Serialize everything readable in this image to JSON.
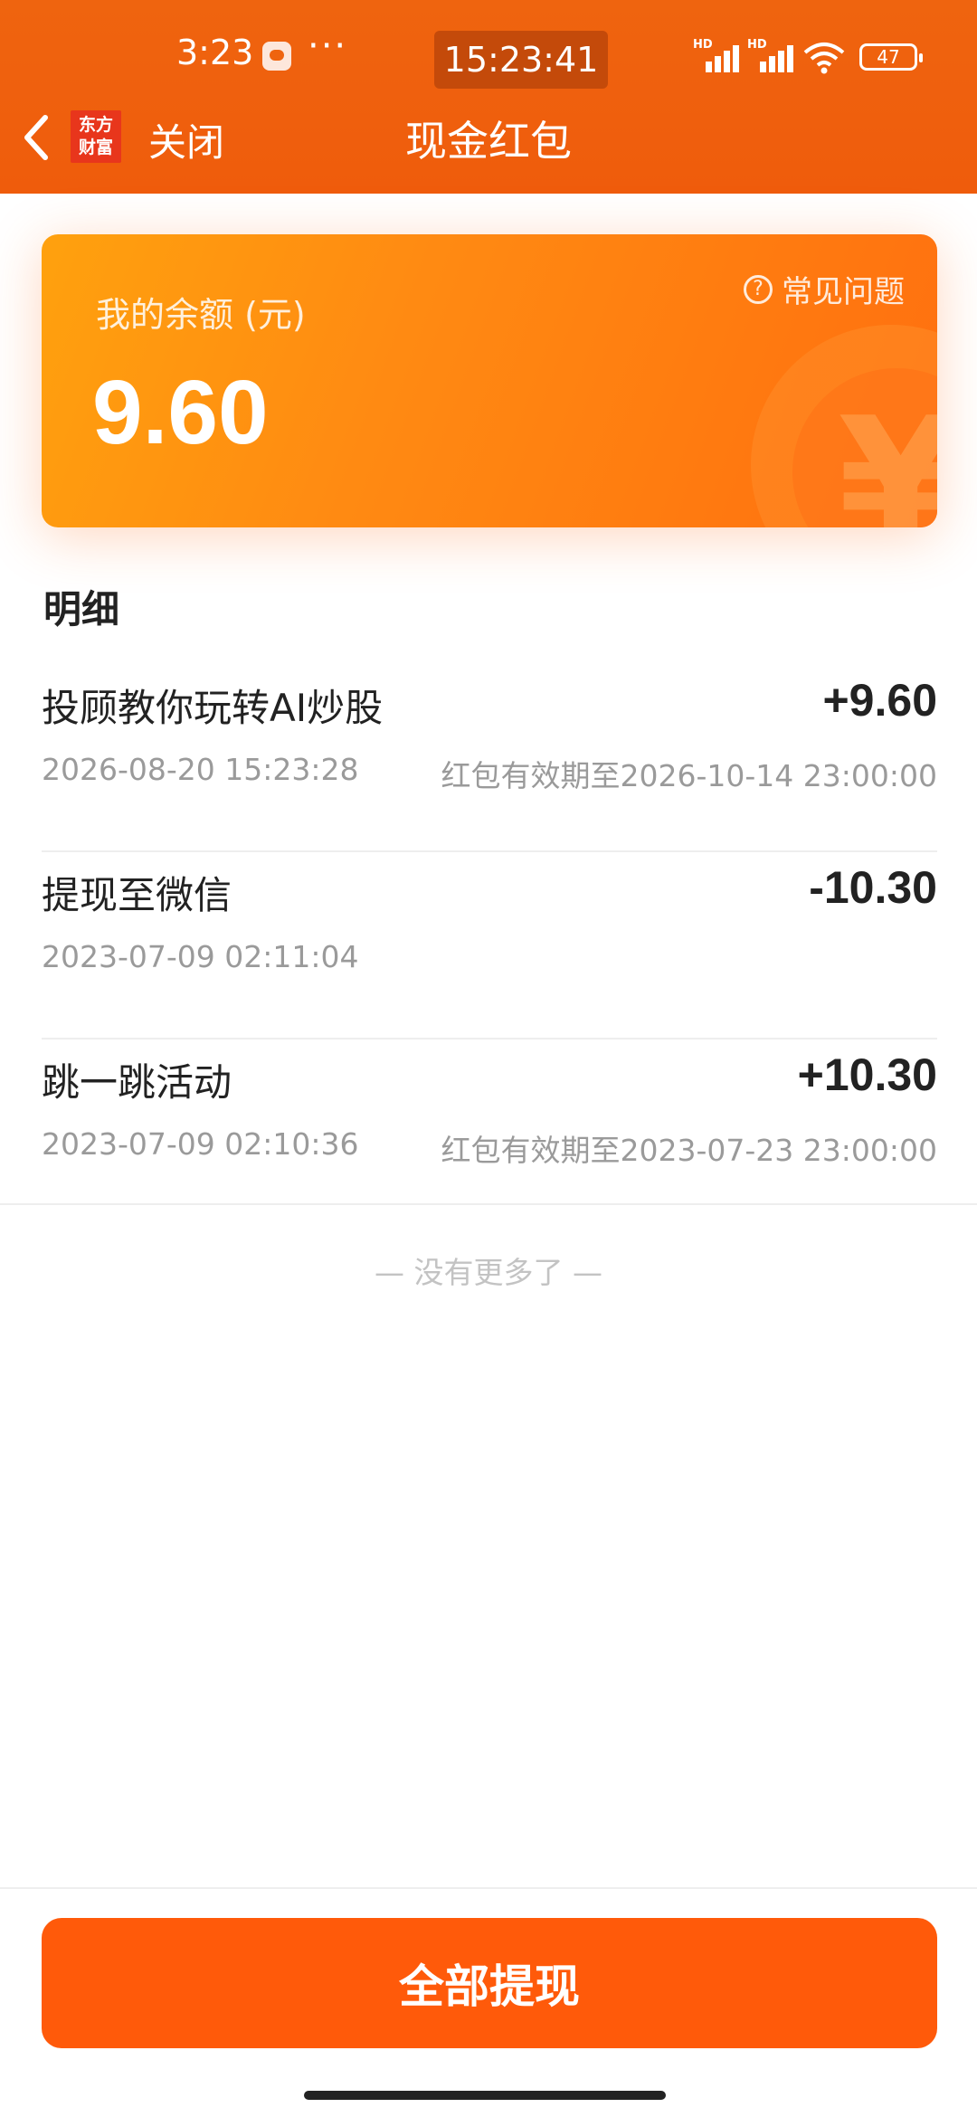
{
  "status_bar": {
    "time": "3:23",
    "dots": "···",
    "clock": "15:23:41",
    "hd_label": "HD",
    "battery": "47"
  },
  "nav": {
    "logo_line1": "东方",
    "logo_line2": "财富",
    "close_label": "关闭",
    "title": "现金红包"
  },
  "balance_card": {
    "label": "我的余额 (元)",
    "value": "9.60",
    "faq_label": "常见问题",
    "faq_icon": "?"
  },
  "details": {
    "title": "明细",
    "items": [
      {
        "name": "投顾教你玩转AI炒股",
        "amount": "+9.60",
        "time": "2026-08-20 15:23:28",
        "expiry": "红包有效期至2026-10-14 23:00:00"
      },
      {
        "name": "提现至微信",
        "amount": "-10.30",
        "time": "2023-07-09 02:11:04",
        "expiry": ""
      },
      {
        "name": "跳一跳活动",
        "amount": "+10.30",
        "time": "2023-07-09 02:10:36",
        "expiry": "红包有效期至2023-07-23 23:00:00"
      }
    ],
    "end_text": "— 没有更多了 —"
  },
  "actions": {
    "withdraw_all_label": "全部提现"
  },
  "colors": {
    "header": "#ef640f",
    "button": "#ff5a0a",
    "card_start": "#ffa10e",
    "card_end": "#ff6f0f"
  },
  "icons": [
    "message-icon",
    "signal-icon",
    "wifi-icon",
    "battery-icon",
    "back-chevron-icon",
    "app-logo",
    "question-circle-icon",
    "yen-coin-decoration"
  ]
}
